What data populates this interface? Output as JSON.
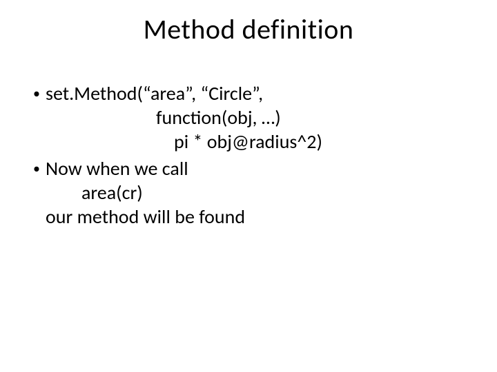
{
  "title": "Method definition",
  "bullets": [
    {
      "lines": [
        {
          "text": "set.Method(“area”, “Circle”,",
          "indentClass": ""
        },
        {
          "text": "function(obj, …)",
          "indentClass": "indent1"
        },
        {
          "text": "pi * obj@radius^2)",
          "indentClass": "indent2"
        }
      ]
    },
    {
      "lines": [
        {
          "text": "Now when we call",
          "indentClass": ""
        },
        {
          "text": "area(cr)",
          "indentClass": "indent-area"
        },
        {
          "text": "our method will be found",
          "indentClass": ""
        }
      ]
    }
  ]
}
